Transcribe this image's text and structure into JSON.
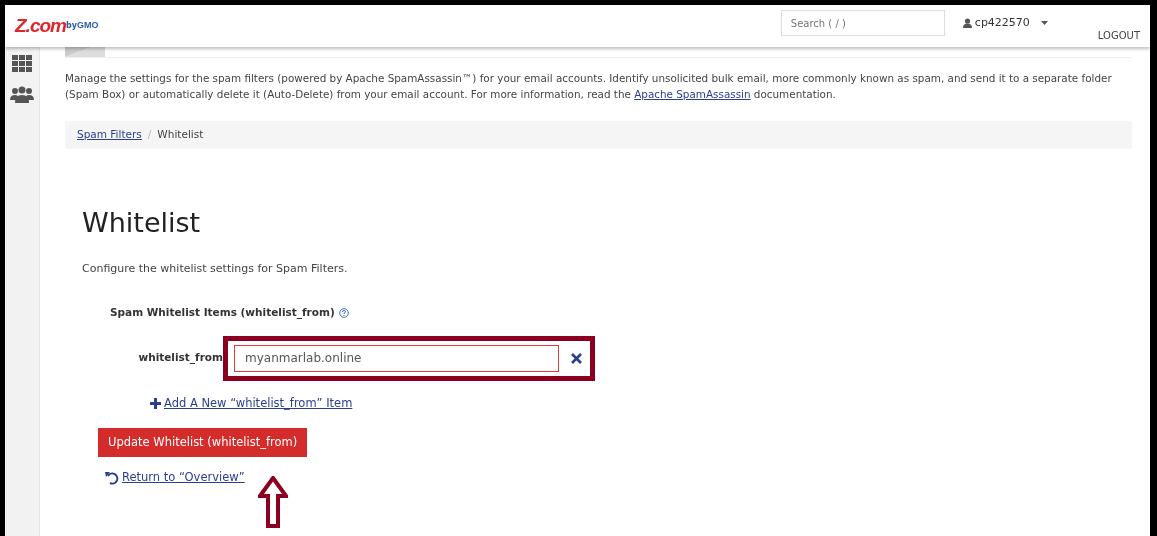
{
  "header": {
    "logo_main": "Z.com",
    "logo_by": "by",
    "logo_brand": "GMO",
    "search": {
      "placeholder": "Search ( / )"
    },
    "user": "cp422570",
    "logout": "LOGOUT"
  },
  "description": {
    "text": "Manage the settings for the spam filters (powered by Apache SpamAssassin™) for your email accounts. Identify unsolicited bulk email, more commonly known as spam, and send it to a separate folder (Spam Box) or automatically delete it (Auto-Delete) from your email account. For more information, read the",
    "link": "Apache SpamAssassin",
    "after": "documentation."
  },
  "breadcrumb_separator": "/",
  "breadcrumb": [
    {
      "label": "Spam Filters",
      "selected": false
    },
    {
      "label": "Whitelist",
      "selected": true
    }
  ],
  "heading": "Whitelist",
  "intro": "Configure the whitelist settings for Spam Filters.",
  "section_label": "Spam Whitelist Items (whitelist_from)",
  "items": [
    {
      "label": "whitelist_from",
      "value": "myanmarlab.online",
      "highlighted": true
    }
  ],
  "add_link": "Add A New “whitelist_from” Item",
  "update_button": "Update Whitelist (whitelist_from)",
  "return_link": "Return to “Overview”",
  "annotation_arrow": true
}
